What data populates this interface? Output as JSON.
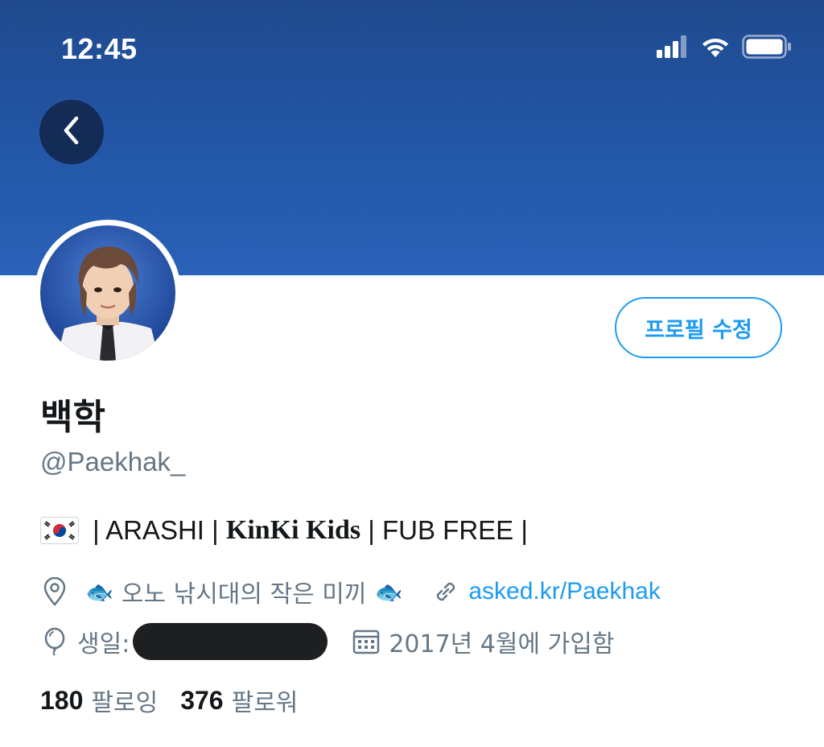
{
  "status_bar": {
    "time": "12:45",
    "icons": [
      "cellular-signal-icon",
      "wifi-icon",
      "battery-icon"
    ]
  },
  "header": {
    "back_icon": "chevron-left-icon",
    "banner_color": "#2357a7"
  },
  "profile": {
    "edit_button_label": "프로필 수정",
    "display_name": "백학",
    "handle": "@Paekhak_",
    "bio": {
      "flag_icon": "south-korea-flag-icon",
      "part1": " | ARASHI | ",
      "part2": "KinKi Kids",
      "part3": " | FUB FREE |"
    },
    "location": {
      "icon": "location-pin-icon",
      "fish_left": "🐟",
      "text": "오노 낚시대의 작은 미끼",
      "fish_right": "🐟"
    },
    "website": {
      "icon": "link-icon",
      "text": "asked.kr/Paekhak"
    },
    "birthday": {
      "icon": "balloon-icon",
      "label": "생일:"
    },
    "joined": {
      "icon": "calendar-icon",
      "text": "2017년 4월에 가입함"
    },
    "following": {
      "count": "180",
      "label": "팔로잉"
    },
    "followers": {
      "count": "376",
      "label": "팔로워"
    }
  },
  "colors": {
    "accent": "#1d9bf0",
    "secondary_text": "#657786",
    "primary_text": "#14171a"
  }
}
